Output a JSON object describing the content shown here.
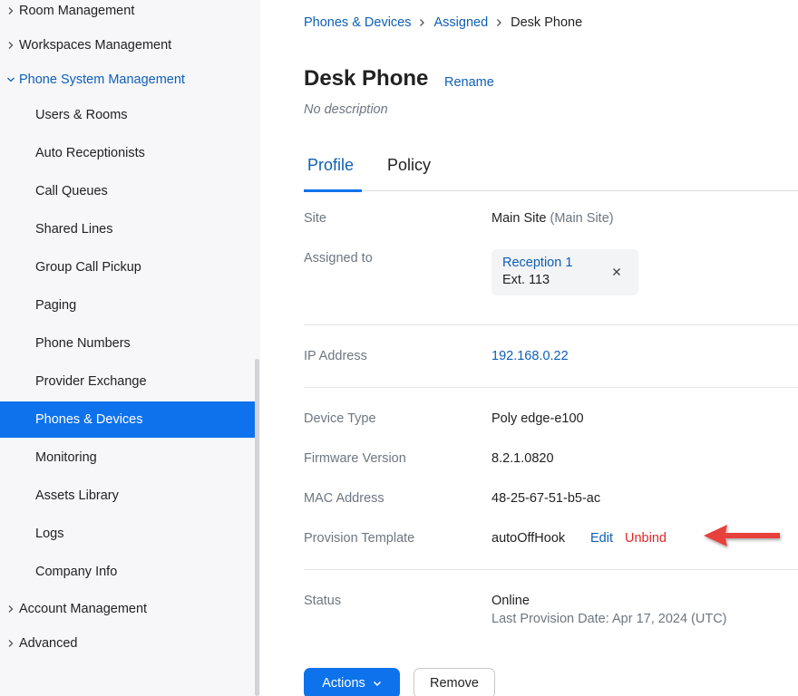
{
  "sidebar": {
    "sections": [
      {
        "label": "Room Management",
        "expanded": false
      },
      {
        "label": "Workspaces Management",
        "expanded": false
      },
      {
        "label": "Phone System Management",
        "expanded": true
      },
      {
        "label": "Account Management",
        "expanded": false
      },
      {
        "label": "Advanced",
        "expanded": false
      }
    ],
    "items": [
      {
        "label": "Users & Rooms"
      },
      {
        "label": "Auto Receptionists"
      },
      {
        "label": "Call Queues"
      },
      {
        "label": "Shared Lines"
      },
      {
        "label": "Group Call Pickup"
      },
      {
        "label": "Paging"
      },
      {
        "label": "Phone Numbers"
      },
      {
        "label": "Provider Exchange"
      },
      {
        "label": "Phones & Devices",
        "active": true
      },
      {
        "label": "Monitoring"
      },
      {
        "label": "Assets Library"
      },
      {
        "label": "Logs"
      },
      {
        "label": "Company Info"
      }
    ]
  },
  "breadcrumb": {
    "items": [
      "Phones & Devices",
      "Assigned"
    ],
    "current": "Desk Phone"
  },
  "header": {
    "title": "Desk Phone",
    "rename_label": "Rename",
    "description": "No description"
  },
  "tabs": [
    {
      "label": "Profile",
      "active": true
    },
    {
      "label": "Policy",
      "active": false
    }
  ],
  "details": {
    "site": {
      "label": "Site",
      "value": "Main Site",
      "note": "(Main Site)"
    },
    "assigned_to": {
      "label": "Assigned to",
      "name": "Reception 1",
      "ext": "Ext. 113"
    },
    "ip_address": {
      "label": "IP Address",
      "value": "192.168.0.22"
    },
    "device_type": {
      "label": "Device Type",
      "value": "Poly edge-e100"
    },
    "firmware_version": {
      "label": "Firmware Version",
      "value": "8.2.1.0820"
    },
    "mac_address": {
      "label": "MAC Address",
      "value": "48-25-67-51-b5-ac"
    },
    "provision_template": {
      "label": "Provision Template",
      "value": "autoOffHook",
      "edit_label": "Edit",
      "unbind_label": "Unbind"
    },
    "status": {
      "label": "Status",
      "value": "Online",
      "sub": "Last Provision Date: Apr 17, 2024 (UTC)"
    }
  },
  "buttons": {
    "actions_label": "Actions",
    "remove_label": "Remove"
  },
  "colors": {
    "accent": "#0e72ed",
    "link": "#0e5fb7",
    "danger": "#e02828",
    "annotation_arrow": "#e8403a"
  },
  "icons": {
    "section_chevron": "chevron-right-icon",
    "expanded_chevron": "chevron-down-icon",
    "breadcrumb_separator": "chevron-right-icon",
    "remove_assignee": "close-icon",
    "actions_dropdown": "chevron-down-icon",
    "annotation": "red-arrow-icon"
  }
}
